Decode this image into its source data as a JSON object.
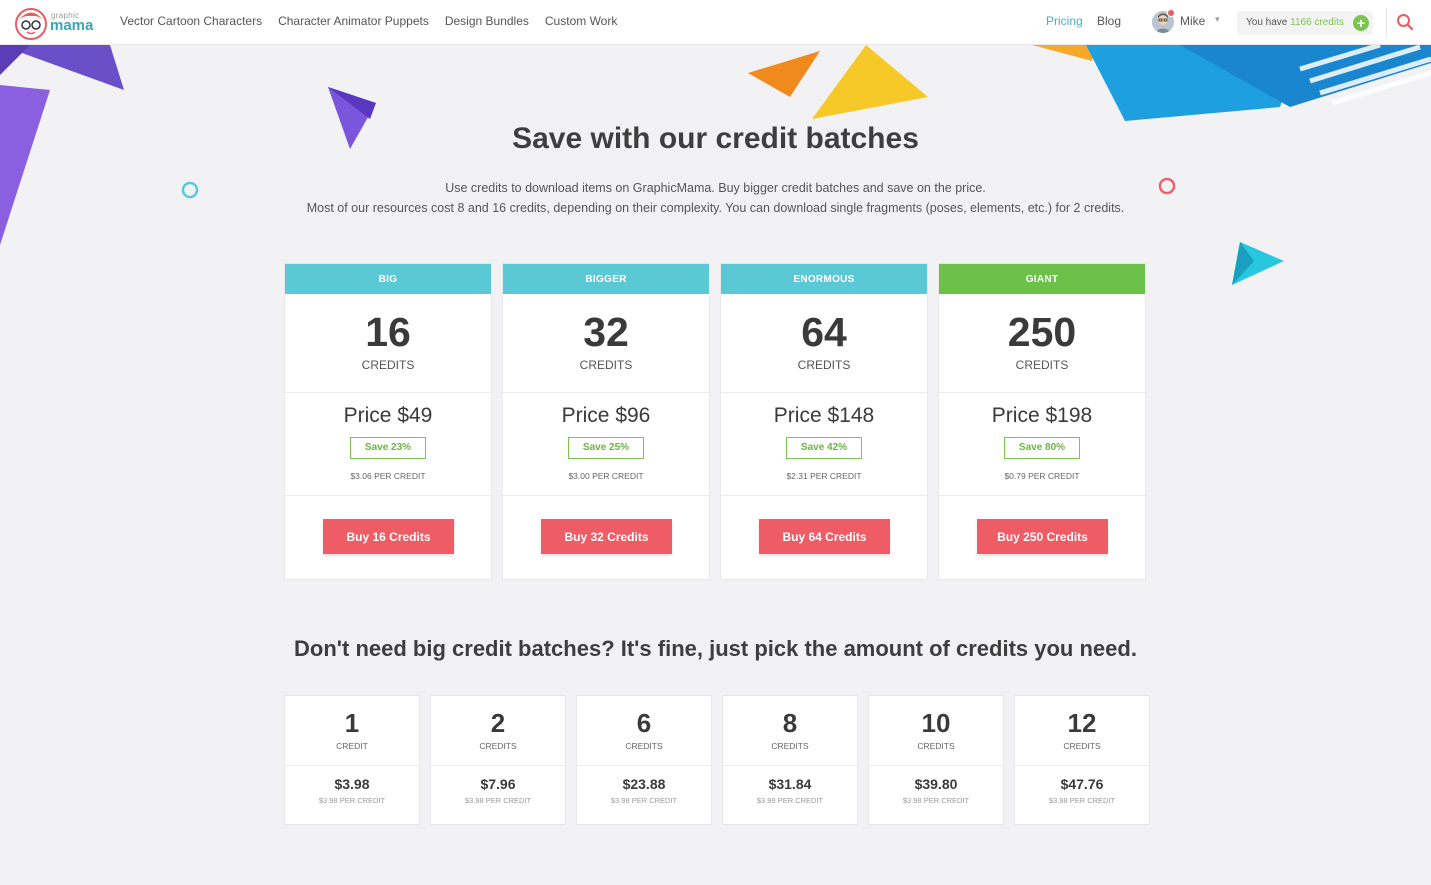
{
  "header": {
    "logo_small": "graphic",
    "logo_main": "mama",
    "nav": [
      "Vector Cartoon Characters",
      "Character Animator Puppets",
      "Design Bundles",
      "Custom Work"
    ],
    "pricing_label": "Pricing",
    "blog_label": "Blog",
    "user_name": "Mike",
    "credits_prefix": "You have ",
    "credits_value": "1166 credits",
    "accent_color": "#4aaebf",
    "credits_color": "#7cc34f"
  },
  "hero": {
    "title": "Save with our credit batches",
    "line1": "Use credits to download items on GraphicMama. Buy bigger credit batches and save on the price.",
    "line2": "Most of our resources cost 8 and 16 credits, depending on their complexity. You can download single fragments (poses, elements, etc.) for 2 credits."
  },
  "batches": [
    {
      "label": "BIG",
      "credits": "16",
      "unit": "CREDITS",
      "price": "Price $49",
      "save": "Save 23%",
      "per": "$3.06 PER CREDIT",
      "button": "Buy 16 Credits",
      "color": "#5bc8d6"
    },
    {
      "label": "BIGGER",
      "credits": "32",
      "unit": "CREDITS",
      "price": "Price $96",
      "save": "Save 25%",
      "per": "$3.00 PER CREDIT",
      "button": "Buy 32 Credits",
      "color": "#5bc8d6"
    },
    {
      "label": "ENORMOUS",
      "credits": "64",
      "unit": "CREDITS",
      "price": "Price $148",
      "save": "Save 42%",
      "per": "$2.31 PER CREDIT",
      "button": "Buy 64 Credits",
      "color": "#5bc8d6"
    },
    {
      "label": "GIANT",
      "credits": "250",
      "unit": "CREDITS",
      "price": "Price $198",
      "save": "Save 80%",
      "per": "$0.79 PER CREDIT",
      "button": "Buy 250 Credits",
      "color": "#6cc14a"
    }
  ],
  "small_title": "Don't need big credit batches? It's fine, just pick the amount of credits you need.",
  "small_packs": [
    {
      "credits": "1",
      "unit": "CREDIT",
      "price": "$3.98",
      "per": "$3.98 PER CREDIT"
    },
    {
      "credits": "2",
      "unit": "CREDITS",
      "price": "$7.96",
      "per": "$3.98 PER CREDIT"
    },
    {
      "credits": "6",
      "unit": "CREDITS",
      "price": "$23.88",
      "per": "$3.98 PER CREDIT"
    },
    {
      "credits": "8",
      "unit": "CREDITS",
      "price": "$31.84",
      "per": "$3.98 PER CREDIT"
    },
    {
      "credits": "10",
      "unit": "CREDITS",
      "price": "$39.80",
      "per": "$3.98 PER CREDIT"
    },
    {
      "credits": "12",
      "unit": "CREDITS",
      "price": "$47.76",
      "per": "$3.98 PER CREDIT"
    }
  ],
  "icons": {
    "search": "search-icon",
    "add": "plus-icon",
    "caret": "chevron-down-icon"
  }
}
